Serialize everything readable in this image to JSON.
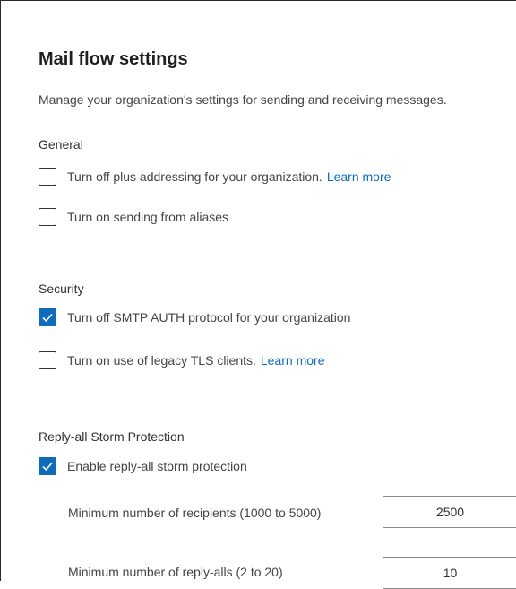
{
  "page": {
    "title": "Mail flow settings",
    "description": "Manage your organization's settings for sending and receiving messages."
  },
  "general": {
    "heading": "General",
    "plus_addressing": {
      "label": "Turn off plus addressing for your organization.",
      "link": "Learn more",
      "checked": false
    },
    "send_from_aliases": {
      "label": "Turn on sending from aliases",
      "checked": false
    }
  },
  "security": {
    "heading": "Security",
    "smtp_auth": {
      "label": "Turn off SMTP AUTH protocol for your organization",
      "checked": true
    },
    "legacy_tls": {
      "label": "Turn on use of legacy TLS clients.",
      "link": "Learn more",
      "checked": false
    }
  },
  "reply_all": {
    "heading": "Reply-all Storm Protection",
    "enable": {
      "label": "Enable reply-all storm protection",
      "checked": true
    },
    "min_recipients": {
      "label": "Minimum number of recipients (1000 to 5000)",
      "value": "2500"
    },
    "min_reply_alls": {
      "label": "Minimum number of reply-alls (2 to 20)",
      "value": "10"
    }
  },
  "colors": {
    "accent": "#0f6cbd",
    "text": "#323130"
  },
  "icons": {
    "checkmark": "checkmark-icon"
  }
}
